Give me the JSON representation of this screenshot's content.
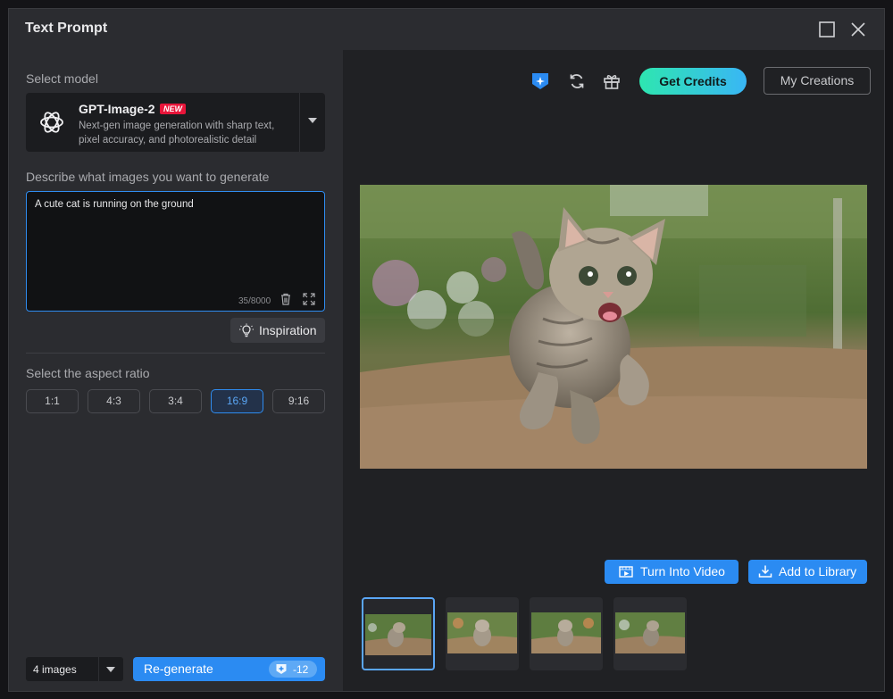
{
  "window": {
    "title": "Text Prompt"
  },
  "model": {
    "section_label": "Select model",
    "name": "GPT-Image-2",
    "badge": "NEW",
    "description": "Next-gen image generation with sharp text, pixel accuracy, and photorealistic detail"
  },
  "prompt": {
    "section_label": "Describe what images you want to generate",
    "value": "A cute cat is running on the ground",
    "char_count": "35/8000"
  },
  "inspiration_label": "Inspiration",
  "aspect": {
    "section_label": "Select the aspect ratio",
    "options": [
      "1:1",
      "4:3",
      "3:4",
      "16:9",
      "9:16"
    ],
    "selected": "16:9"
  },
  "image_count": "4 images",
  "regenerate": {
    "label": "Re-generate",
    "cost": "-12"
  },
  "toolbar": {
    "credits_label": "Get Credits",
    "creations_label": "My Creations"
  },
  "actions": {
    "video_label": "Turn Into Video",
    "library_label": "Add to Library"
  },
  "thumbnails": {
    "count": 4,
    "selected_index": 0
  },
  "colors": {
    "accent": "#2b8bf2",
    "credits_gradient_start": "#2ee6b0",
    "credits_gradient_end": "#39b6f5",
    "badge": "#e8153a"
  }
}
